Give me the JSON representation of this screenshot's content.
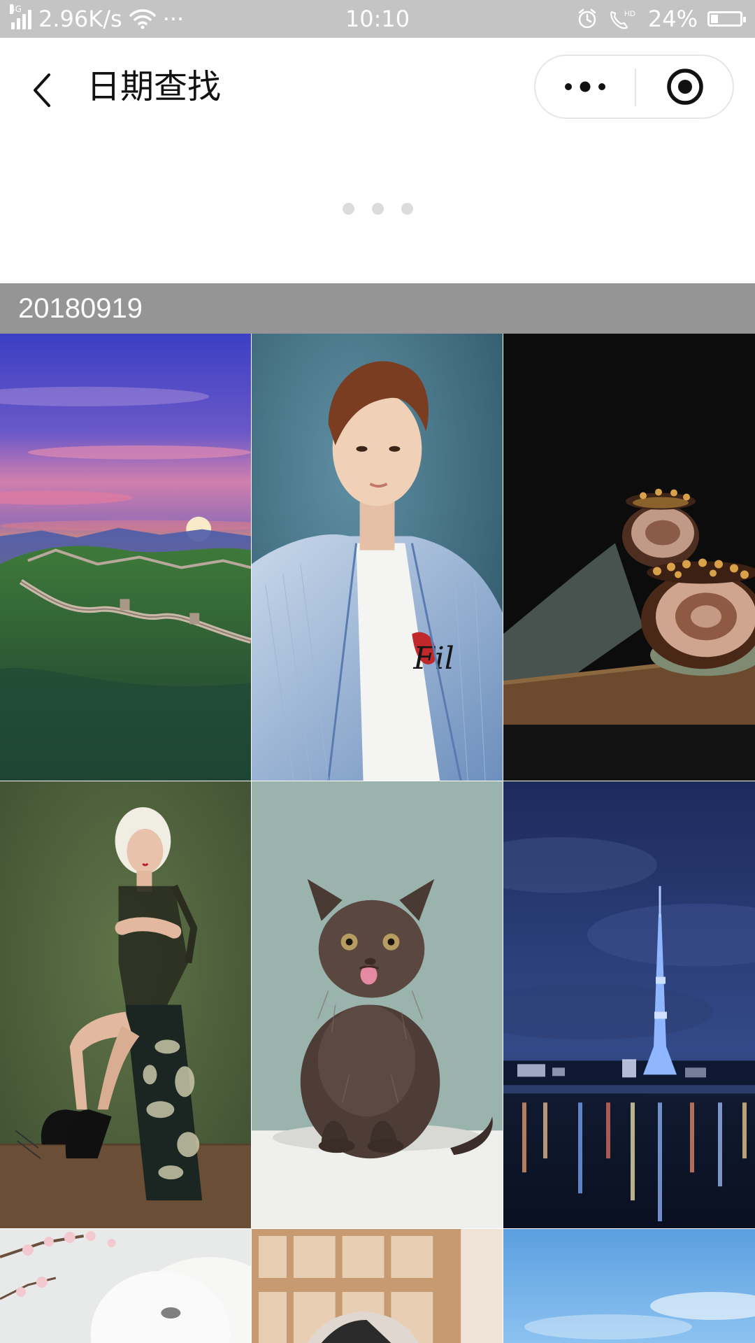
{
  "status_bar": {
    "network": "4G",
    "speed": "2.96K/s",
    "more": "···",
    "time": "10:10",
    "battery_percent": "24%",
    "battery_level": 0.24,
    "icons": [
      "signal-icon",
      "wifi-icon",
      "alarm-icon",
      "hd-call-icon",
      "battery-icon"
    ]
  },
  "nav": {
    "title": "日期查找",
    "icons": [
      "back-icon",
      "more-dots-icon",
      "close-target-icon"
    ]
  },
  "carousel": {
    "dot_count": 3,
    "colors": {
      "dot": "#dcdcdc"
    }
  },
  "section": {
    "date": "20180919"
  },
  "photos": [
    {
      "subject": "great-wall-sunset"
    },
    {
      "subject": "man-portrait"
    },
    {
      "subject": "chocolate-roll-cake"
    },
    {
      "subject": "woman-fashion"
    },
    {
      "subject": "kitten"
    },
    {
      "subject": "tokyo-skytree-night"
    },
    {
      "subject": "teapot-blossoms"
    },
    {
      "subject": "window-portrait"
    },
    {
      "subject": "blue-sky"
    }
  ],
  "colors": {
    "status_bar": "#c4c4c4",
    "date_header": "#959595",
    "nav_background": "#ffffff"
  }
}
